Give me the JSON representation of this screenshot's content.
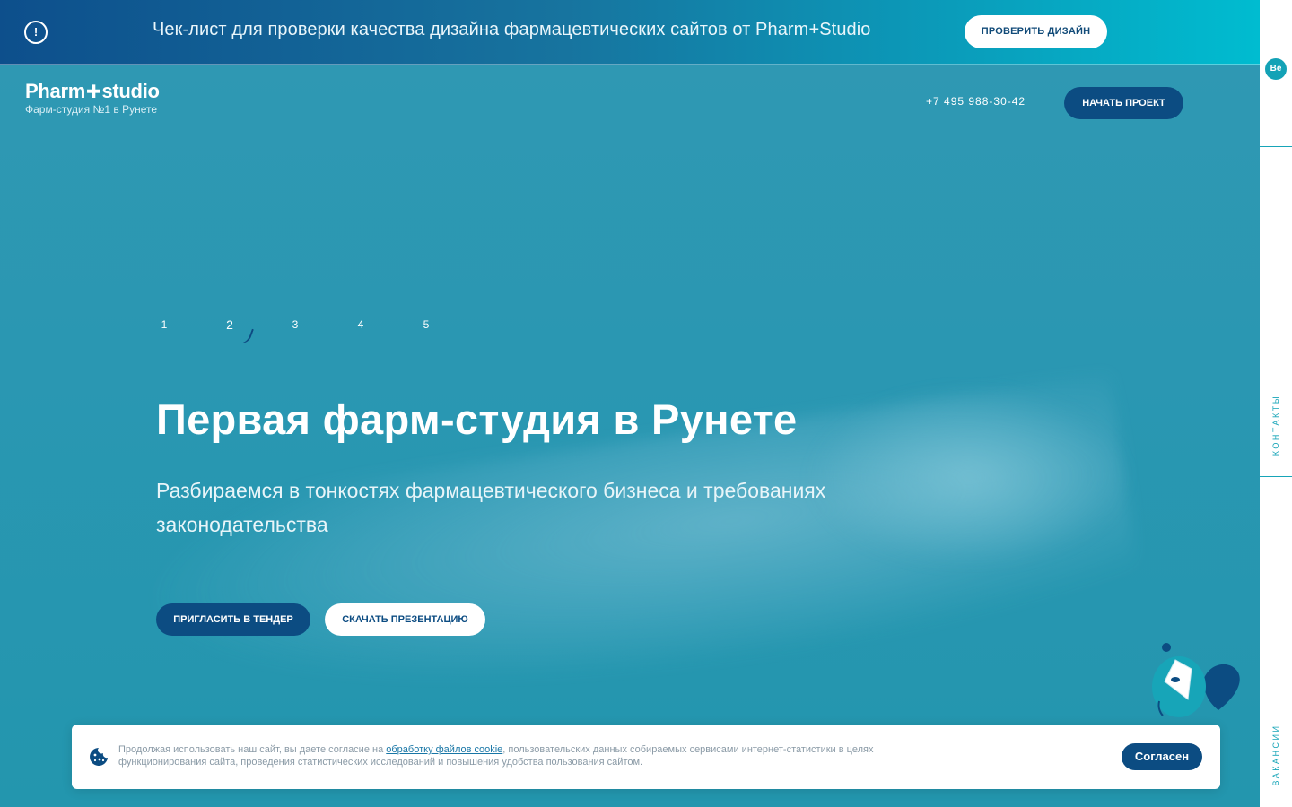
{
  "promo": {
    "icon": "exclamation-icon",
    "text": "Чек-лист для проверки качества дизайна фармацевтических сайтов от Pharm+Studio",
    "button": "ПРОВЕРИТЬ ДИЗАЙН"
  },
  "header": {
    "logo_left": "Pharm",
    "logo_plus": "✚",
    "logo_right": "studio",
    "tagline": "Фарм-студия №1 в Рунете",
    "phone": "+7 495 988-30-42",
    "start_button": "НАЧАТЬ ПРОЕКТ"
  },
  "sidebar": {
    "behance_label": "Bē",
    "contacts": "КОНТАКТЫ",
    "vacancies": "ВАКАНСИИ"
  },
  "slider": {
    "numbers": [
      "1",
      "2",
      "3",
      "4",
      "5"
    ],
    "active_index": 2
  },
  "hero": {
    "title": "Первая фарм-студия в Рунете",
    "subtitle": "Разбираемся в тонкостях фармацевтического бизнеса и требованиях законодательства",
    "button_tender": "ПРИГЛАСИТЬ В ТЕНДЕР",
    "button_presentation": "СКАЧАТЬ ПРЕЗЕНТАЦИЮ"
  },
  "cookie": {
    "icon": "cookie-icon",
    "text_before": "Продолжая использовать наш сайт, вы даете согласие на ",
    "link": "обработку файлов cookie",
    "text_after": ", пользовательских данных собираемых сервисами интернет-статистики в целях функционирования сайта, проведения статистических исследований и повышения удобства пользования сайтом.",
    "button": "Согласен"
  },
  "colors": {
    "brand_dark": "#0c4c82",
    "accent": "#17a5b8",
    "hero_bg": "#2a96b0"
  }
}
